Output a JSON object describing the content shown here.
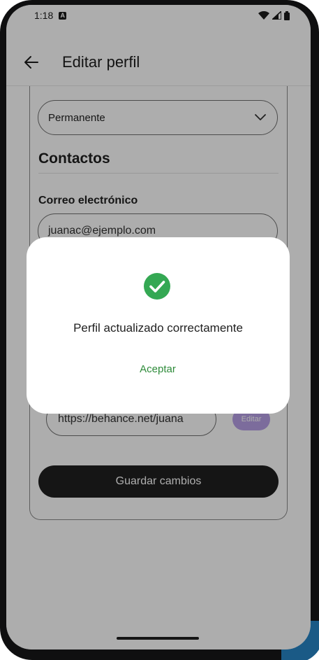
{
  "status_bar": {
    "time": "1:18",
    "badge": "A"
  },
  "app_bar": {
    "title": "Editar perfil"
  },
  "form": {
    "permanence_value": "Permanente",
    "contacts_title": "Contactos",
    "email_label": "Correo electrónico",
    "email_value": "juanac@ejemplo.com",
    "url_value": "https://behance.net/juana",
    "edit_chip": "Editar",
    "save_label": "Guardar cambios"
  },
  "dialog": {
    "message": "Perfil actualizado correctamente",
    "action_label": "Aceptar"
  },
  "colors": {
    "success": "#34a853",
    "action": "#2e8b3a",
    "primary_button": "#1f1f1f"
  }
}
